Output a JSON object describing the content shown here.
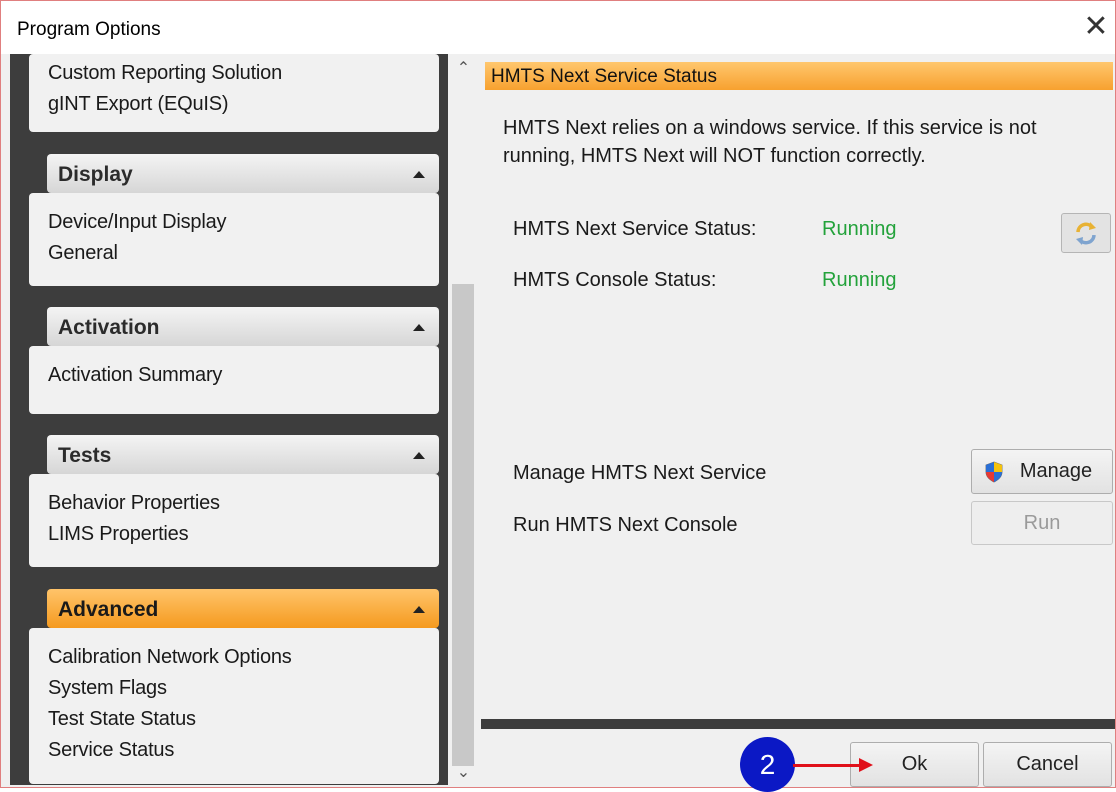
{
  "window": {
    "title": "Program Options",
    "close_glyph": "✕"
  },
  "sidebar": {
    "top_items": [
      "Custom Reporting Solution",
      "gINT Export (EQuIS)"
    ],
    "sections": [
      {
        "title": "Display",
        "items": [
          "Device/Input Display",
          "General"
        ]
      },
      {
        "title": "Activation",
        "items": [
          "Activation Summary"
        ]
      },
      {
        "title": "Tests",
        "items": [
          "Behavior Properties",
          "LIMS Properties"
        ]
      },
      {
        "title": "Advanced",
        "items": [
          "Calibration Network Options",
          "System Flags",
          "Test State Status",
          "Service Status"
        ]
      }
    ],
    "active_section": "Advanced"
  },
  "scrollbar": {
    "up": "⌃",
    "down": "⌄"
  },
  "panel": {
    "title": "HMTS Next Service Status",
    "description": "HMTS Next relies on a windows service.  If this service is not running, HMTS Next will NOT function correctly.",
    "service_status_label": "HMTS Next Service Status:",
    "service_status_value": "Running",
    "console_status_label": "HMTS Console Status:",
    "console_status_value": "Running",
    "manage_label": "Manage HMTS Next Service",
    "manage_button": "Manage",
    "run_label": "Run HMTS Next Console",
    "run_button": "Run"
  },
  "footer": {
    "ok": "Ok",
    "cancel": "Cancel"
  },
  "annotation": {
    "step": "2"
  },
  "colors": {
    "accent": "#f7a12f",
    "status_ok": "#23a23b",
    "badge": "#0b18c5",
    "arrow": "#e0101a",
    "sidebar_bg": "#3d3d3d"
  }
}
